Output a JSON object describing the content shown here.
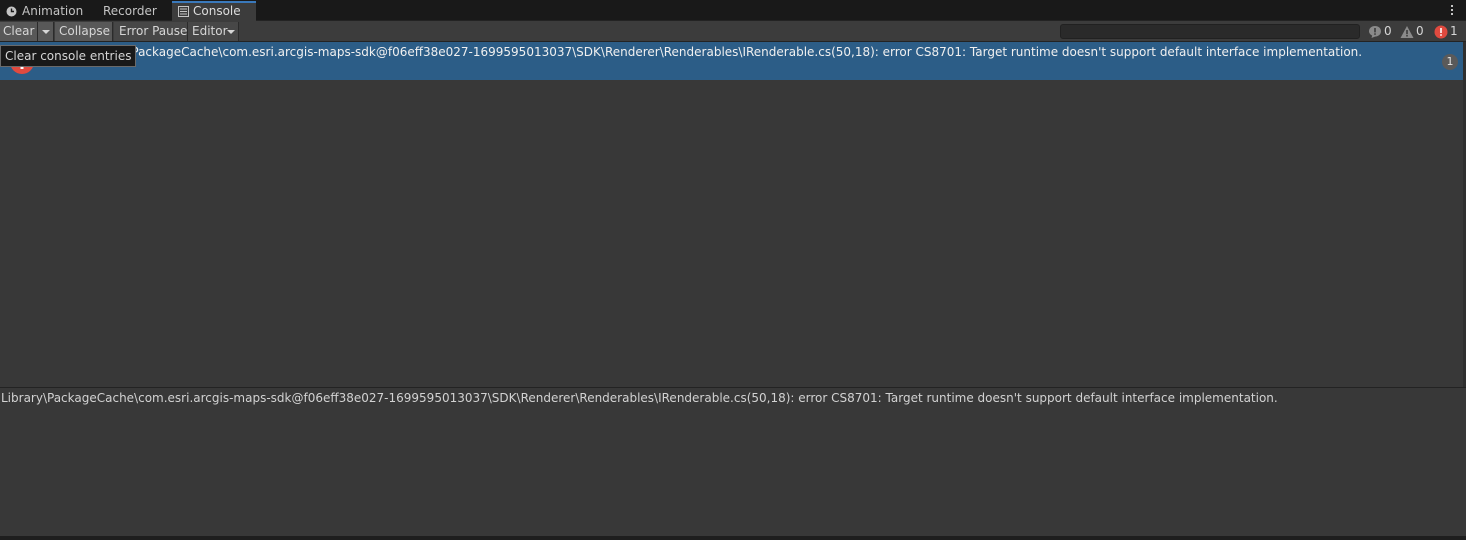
{
  "tabs": [
    {
      "label": "Animation",
      "icon": "clock-icon"
    },
    {
      "label": "Recorder",
      "icon": ""
    },
    {
      "label": "Console",
      "icon": "console-icon",
      "active": true
    }
  ],
  "toolbar": {
    "clear_label": "Clear",
    "collapse_label": "Collapse",
    "error_pause_label": "Error Pause",
    "editor_label": "Editor"
  },
  "search": {
    "value": "",
    "placeholder": ""
  },
  "counters": {
    "info": "0",
    "warning": "0",
    "error": "1"
  },
  "tooltip": "Clear console entries",
  "entries": [
    {
      "type": "error",
      "text": "Library\\PackageCache\\com.esri.arcgis-maps-sdk@f06eff38e027-1699595013037\\SDK\\Renderer\\Renderables\\IRenderable.cs(50,18): error CS8701: Target runtime doesn't support default interface implementation.",
      "visible_text": "rary\\PackageCache\\com.esri.arcgis-maps-sdk@f06eff38e027-1699595013037\\SDK\\Renderer\\Renderables\\IRenderable.cs(50,18): error CS8701: Target runtime doesn't support default interface implementation.",
      "count": "1"
    }
  ],
  "detail": "Library\\PackageCache\\com.esri.arcgis-maps-sdk@f06eff38e027-1699595013037\\SDK\\Renderer\\Renderables\\IRenderable.cs(50,18): error CS8701: Target runtime doesn't support default interface implementation.",
  "colors": {
    "selection": "#2c5d87",
    "error": "#e04a3f",
    "accent": "#3a79bb"
  }
}
